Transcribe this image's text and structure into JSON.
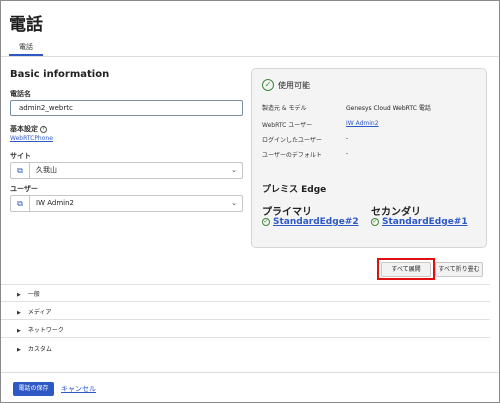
{
  "page": {
    "title": "電話"
  },
  "tabs": [
    {
      "label": "電話",
      "active": true
    }
  ],
  "basic_info": {
    "heading": "Basic information",
    "phone_name_label": "電話名",
    "phone_name_value": "admin2_webrtc",
    "base_settings_label": "基本設定",
    "base_settings_link": "WebRTCPhone",
    "site_label": "サイト",
    "site_value": "久我山",
    "user_label": "ユーザー",
    "user_value": "IW Admin2"
  },
  "status_panel": {
    "status": "使用可能",
    "rows": [
      {
        "key": "製造元 & モデル",
        "value": "Genesys Cloud WebRTC 電話",
        "link": false
      },
      {
        "key": "WebRTC ユーザー",
        "value": "IW Admin2",
        "link": true
      },
      {
        "key": "ログインしたユーザー",
        "value": "-",
        "link": false
      },
      {
        "key": "ユーザーのデフォルト",
        "value": "-",
        "link": false
      }
    ],
    "edge_heading": "プレミス Edge",
    "primary_label": "プライマリ",
    "primary_edge": "StandardEdge#2",
    "secondary_label": "セカンダリ",
    "secondary_edge": "StandardEdge#1"
  },
  "actions": {
    "expand_all": "すべて展開",
    "collapse_all": "すべて折り畳む"
  },
  "accordion": [
    {
      "label": "一般"
    },
    {
      "label": "メディア"
    },
    {
      "label": "ネットワーク"
    },
    {
      "label": "カスタム"
    }
  ],
  "footer": {
    "save": "電話の保存",
    "cancel": "キャンセル"
  },
  "colors": {
    "accent": "#2e58c4",
    "highlight": "#e01010",
    "ok": "#3c8a3c"
  }
}
